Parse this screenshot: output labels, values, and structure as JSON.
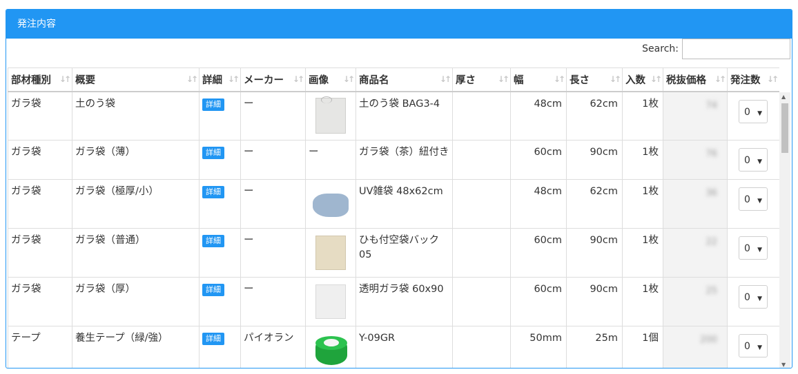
{
  "panel": {
    "title": "発注内容"
  },
  "search": {
    "label": "Search:",
    "value": ""
  },
  "columns": [
    "部材種別",
    "概要",
    "詳細",
    "メーカー",
    "画像",
    "商品名",
    "厚さ",
    "幅",
    "長さ",
    "入数",
    "税抜価格",
    "発注数"
  ],
  "detail_label": "詳細",
  "rows": [
    {
      "type": "ガラ袋",
      "summary": "土のう袋",
      "maker": "ー",
      "image": "white-bag-image",
      "name": "土のう袋 BAG3-4",
      "thickness": "",
      "width": "48cm",
      "length": "62cm",
      "count": "1枚",
      "price": "74",
      "qty": "0"
    },
    {
      "type": "ガラ袋",
      "summary": "ガラ袋（薄）",
      "maker": "ー",
      "image": "ー",
      "name": "ガラ袋（茶）紐付き",
      "thickness": "",
      "width": "60cm",
      "length": "90cm",
      "count": "1枚",
      "price": "76",
      "qty": "0"
    },
    {
      "type": "ガラ袋",
      "summary": "ガラ袋（極厚/小）",
      "maker": "ー",
      "image": "blue-bag-image",
      "name": "UV雑袋 48x62cm",
      "thickness": "",
      "width": "48cm",
      "length": "62cm",
      "count": "1枚",
      "price": "36",
      "qty": "0"
    },
    {
      "type": "ガラ袋",
      "summary": "ガラ袋（普通）",
      "maker": "ー",
      "image": "kraft-bag-image",
      "name": "ひも付空袋バック05",
      "thickness": "",
      "width": "60cm",
      "length": "90cm",
      "count": "1枚",
      "price": "22",
      "qty": "0"
    },
    {
      "type": "ガラ袋",
      "summary": "ガラ袋（厚）",
      "maker": "ー",
      "image": "clear-bag-image",
      "name": "透明ガラ袋 60x90",
      "thickness": "",
      "width": "60cm",
      "length": "90cm",
      "count": "1枚",
      "price": "25",
      "qty": "0"
    },
    {
      "type": "テープ",
      "summary": "養生テープ（緑/強）",
      "maker": "パイオラン",
      "image": "green-tape-image",
      "name": "Y-09GR",
      "thickness": "",
      "width": "50mm",
      "length": "25m",
      "count": "1個",
      "price": "200",
      "qty": "0"
    }
  ],
  "sort_icon": "sort-arrows-icon",
  "colors": {
    "accent": "#2196f3",
    "header_text": "#ffffff",
    "grid": "#dddddd"
  }
}
